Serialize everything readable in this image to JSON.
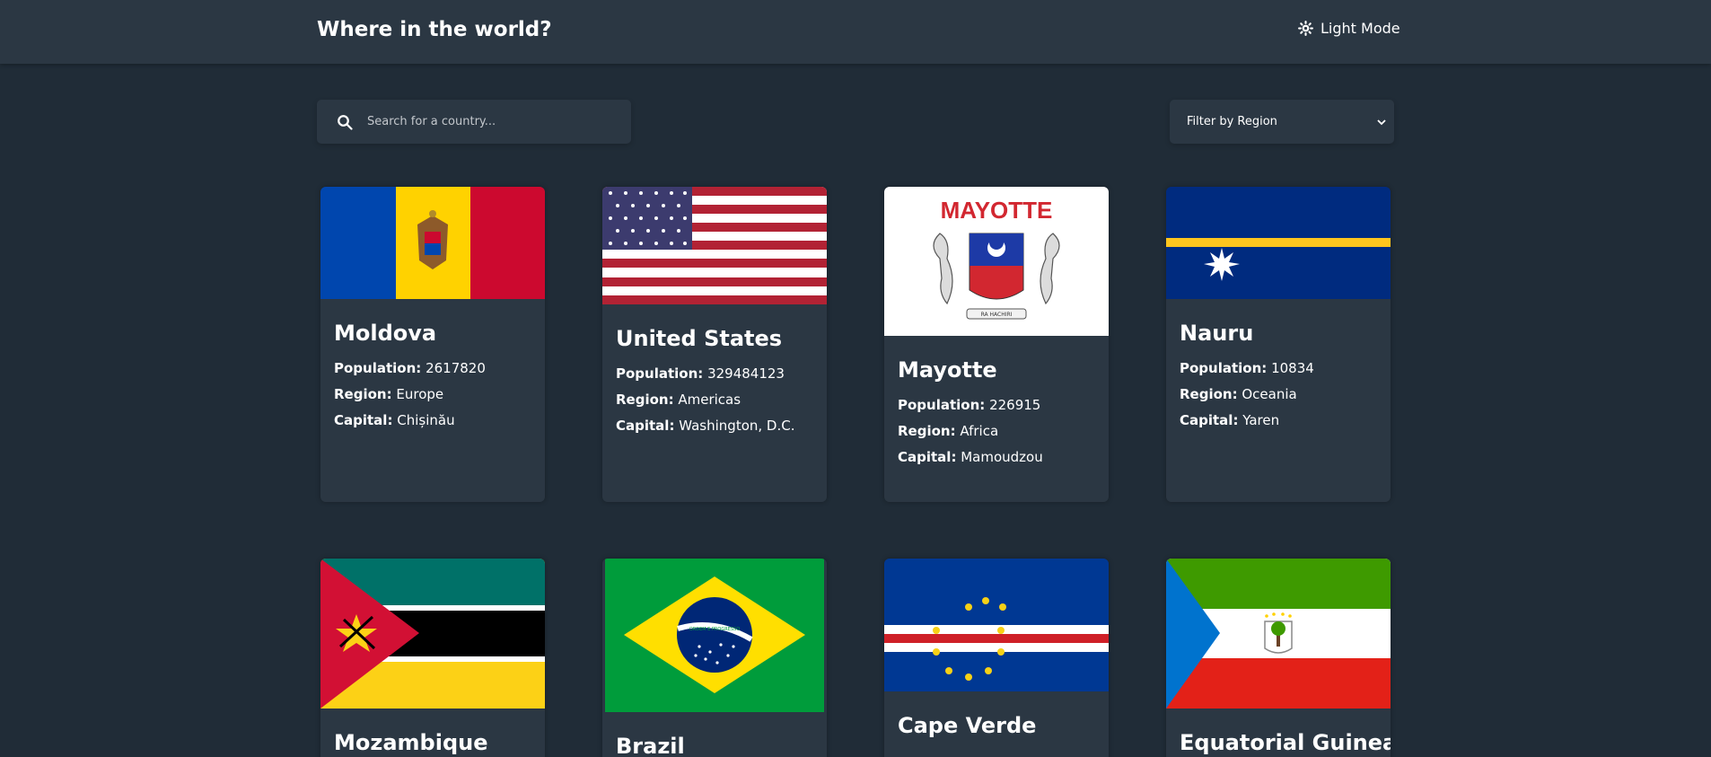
{
  "header": {
    "title": "Where in the world?",
    "mode_label": "Light Mode"
  },
  "search": {
    "placeholder": "Search for a country..."
  },
  "filter": {
    "label": "Filter by Region"
  },
  "labels": {
    "population": "Population:",
    "region": "Region:",
    "capital": "Capital:"
  },
  "countries": [
    {
      "name": "Moldova",
      "population": "2617820",
      "region": "Europe",
      "capital": "Chișinău",
      "flag_icon": "moldova-flag"
    },
    {
      "name": "United States",
      "population": "329484123",
      "region": "Americas",
      "capital": "Washington, D.C.",
      "flag_icon": "usa-flag"
    },
    {
      "name": "Mayotte",
      "population": "226915",
      "region": "Africa",
      "capital": "Mamoudzou",
      "flag_icon": "mayotte-flag",
      "flag_text": "MAYOTTE",
      "flag_motto": "RA HACHIRI"
    },
    {
      "name": "Nauru",
      "population": "10834",
      "region": "Oceania",
      "capital": "Yaren",
      "flag_icon": "nauru-flag"
    },
    {
      "name": "Mozambique",
      "flag_icon": "mozambique-flag"
    },
    {
      "name": "Brazil",
      "flag_icon": "brazil-flag",
      "flag_motto": "ORDEM E PROGRESSO"
    },
    {
      "name": "Cape Verde",
      "flag_icon": "cape-verde-flag"
    },
    {
      "name": "Equatorial Guinea",
      "flag_icon": "equatorial-guinea-flag"
    }
  ]
}
